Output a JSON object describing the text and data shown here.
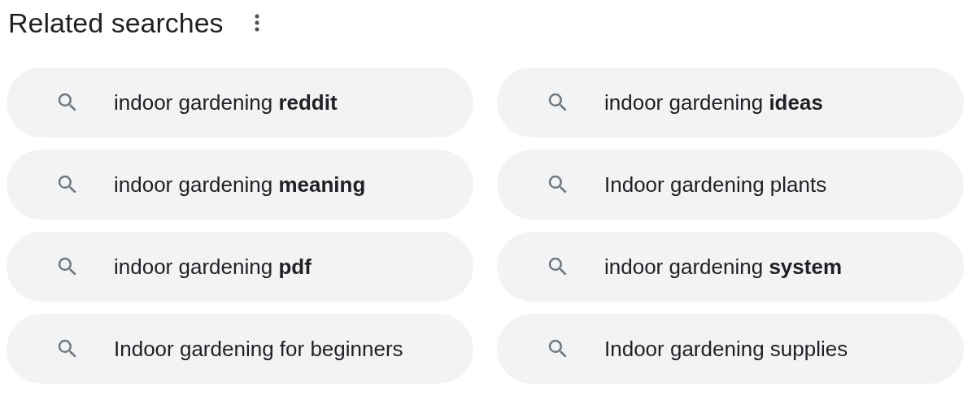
{
  "heading": "Related searches",
  "searches": [
    {
      "text": "indoor gardening **reddit**"
    },
    {
      "text": "indoor gardening **ideas**"
    },
    {
      "text": "indoor gardening **meaning**"
    },
    {
      "text": "Indoor gardening plants"
    },
    {
      "text": "indoor gardening **pdf**"
    },
    {
      "text": "indoor gardening **system**"
    },
    {
      "text": "Indoor gardening for beginners"
    },
    {
      "text": "Indoor gardening supplies"
    }
  ]
}
